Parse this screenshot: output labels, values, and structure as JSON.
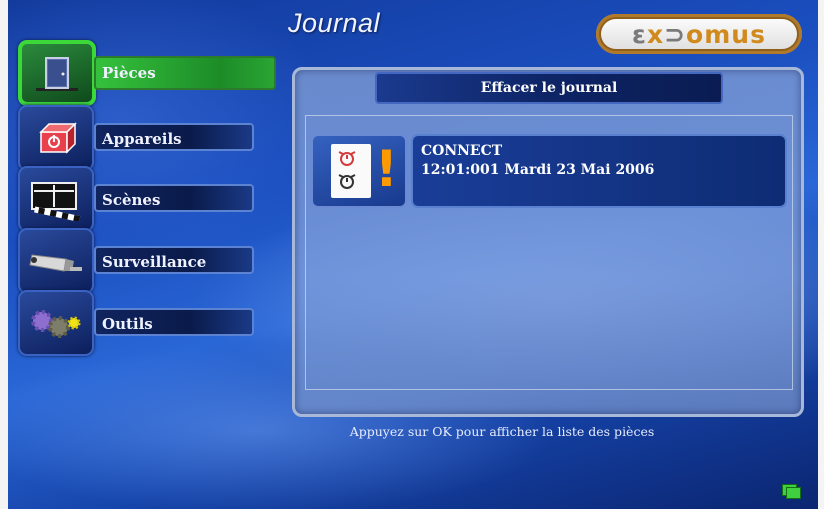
{
  "header": {
    "title": "Journal",
    "logo_text_a": "ex",
    "logo_text_b": "Domus"
  },
  "menu": [
    {
      "label": "Pièces",
      "icon": "door-icon",
      "active": true
    },
    {
      "label": "Appareils",
      "icon": "power-box-icon",
      "active": false
    },
    {
      "label": "Scènes",
      "icon": "clapperboard-icon",
      "active": false
    },
    {
      "label": "Surveillance",
      "icon": "camera-icon",
      "active": false
    },
    {
      "label": "Outils",
      "icon": "gears-icon",
      "active": false
    }
  ],
  "panel": {
    "clear_button": "Effacer le journal",
    "entries": [
      {
        "event": "CONNECT",
        "datetime": "12:01:001 Mardi 23 Mai 2006",
        "icon": "alert-icon"
      }
    ]
  },
  "footer": {
    "hint": "Appuyez sur OK pour afficher la liste des pièces"
  },
  "colors": {
    "active": "#35c13c",
    "alert": "#ff9a00",
    "accent": "#d08a1e"
  }
}
